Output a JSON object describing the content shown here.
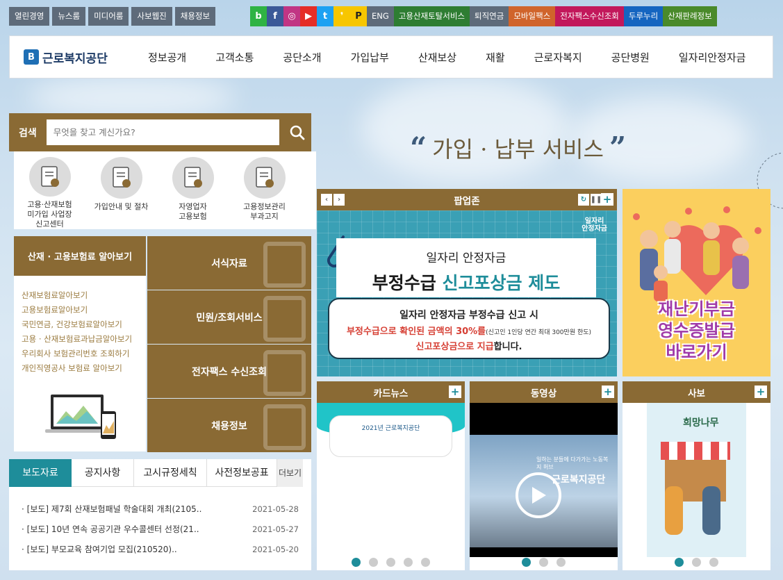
{
  "util_left": [
    "열린경영",
    "뉴스룸",
    "미디어룸",
    "사보웹진",
    "채용정보"
  ],
  "sns": [
    {
      "icon": "blog-icon",
      "glyph": "b",
      "color": "#2fb344"
    },
    {
      "icon": "facebook-icon",
      "glyph": "f",
      "color": "#3b5998"
    },
    {
      "icon": "instagram-icon",
      "glyph": "◎",
      "color": "#c13584"
    },
    {
      "icon": "youtube-icon",
      "glyph": "▶",
      "color": "#e52d27"
    },
    {
      "icon": "twitter-icon",
      "glyph": "t",
      "color": "#1da1f2"
    },
    {
      "icon": "kakaostory-icon",
      "glyph": "❜",
      "color": "#f7c600"
    },
    {
      "icon": "kakaopay-icon",
      "glyph": "P",
      "color": "#f7c600"
    }
  ],
  "util_right": [
    {
      "label": "ENG",
      "color": "#5e6b7a"
    },
    {
      "label": "고용산재토탈서비스",
      "color": "#2e7d32"
    },
    {
      "label": "퇴직연금",
      "color": "#5e6b7a"
    },
    {
      "label": "모바일팩스",
      "color": "#d0642b"
    },
    {
      "label": "전자팩스수신조회",
      "color": "#c2185b"
    },
    {
      "label": "두루누리",
      "color": "#1565c0"
    },
    {
      "label": "산재판례정보",
      "color": "#4a8a2a"
    }
  ],
  "logo": {
    "mark": "B",
    "text": "근로복지공단"
  },
  "menu": [
    "정보공개",
    "고객소통",
    "공단소개",
    "가입납부",
    "산재보상",
    "재활",
    "근로자복지",
    "공단병원",
    "일자리안정자금"
  ],
  "search": {
    "label": "검색",
    "placeholder": "무엇을 찾고 계신가요?"
  },
  "quick": [
    "고용·산재보험\n미가입 사업장\n신고센터",
    "가입안내 및 절차",
    "자영업자\n고용보험",
    "고용정보관리\n부과고지"
  ],
  "insurance": {
    "title": "산재 · 고용보험료 알아보기",
    "links": [
      "산재보험료알아보기",
      "고용보험료알아보기",
      "국민연금, 건강보험료알아보기",
      "고용 · 산재보험료과납금알아보기",
      "우리회사 보험관리번호 조회하기",
      "개인직영공사 보험료 알아보기"
    ]
  },
  "tiles": [
    "서식자료",
    "민원/조회서비스",
    "전자팩스 수신조회",
    "채용정보"
  ],
  "news": {
    "tabs": [
      "보도자료",
      "공지사항",
      "고시규정세칙",
      "사전정보공표"
    ],
    "more": "더보기",
    "items": [
      {
        "title": "[보도] 제7회 산재보험패널 학술대회 개최(2105..",
        "date": "2021-05-28"
      },
      {
        "title": "[보도] 10년 연속 공공기관 우수콜센터 선정(21..",
        "date": "2021-05-27"
      },
      {
        "title": "[보도] 부모교육 참여기업 모집(210520)..",
        "date": "2021-05-20"
      }
    ]
  },
  "headline": "가입 · 납부 서비스",
  "popup": {
    "title": "팝업존",
    "tag": "일자리\n안정자금",
    "line1": "일자리 안정자금",
    "line2a": "부정수급 ",
    "line2b": "신고포상금 제도",
    "q1": "일자리 안정자금 부정수급 신고 시",
    "q2": "부정수급으로 확인된 금액의 30%를",
    "q2s": "(신고인 1인당 연간 최대 300만원 한도)",
    "q3a": "신고포상금으로 지급",
    "q3b": "합니다."
  },
  "donation": {
    "lines": [
      "재난기부금",
      "영수증발급",
      "바로가기"
    ]
  },
  "cards": [
    {
      "title": "카드뉴스",
      "dots": 5,
      "caption": "2021년 근로복지공단"
    },
    {
      "title": "동영상",
      "dots": 3,
      "caption": "근로복지공단",
      "sub": "일하는 분들에 다가가는 노동복지 허브"
    },
    {
      "title": "사보",
      "dots": 3,
      "caption": "희망나무"
    }
  ]
}
